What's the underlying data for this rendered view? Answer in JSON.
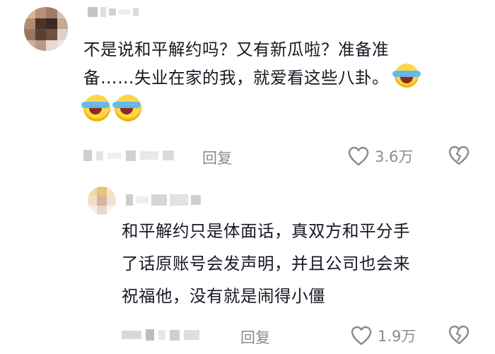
{
  "comment": {
    "text_line1": "不是说和平解约吗？又有新瓜啦？准备准",
    "text_line2": "备……失业在家的我，就爱看这些八卦。",
    "emoji_names": [
      "laughing-tears-emoji",
      "laughing-tears-emoji",
      "laughing-tears-emoji"
    ],
    "reply_label": "回复",
    "like_count": "3.6万"
  },
  "reply": {
    "text_line1": "和平解约只是体面话，真双方和平分手",
    "text_line2": "了话原账号会发声明，并且公司也会来",
    "text_line3": "祝福他，没有就是闹得小僵",
    "reply_label": "回复",
    "like_count": "1.9万"
  },
  "icons": {
    "like": "heart-outline-icon",
    "dislike": "broken-heart-icon"
  },
  "colors": {
    "text": "#161823",
    "meta": "#8a8b91",
    "emoji_yellow": "#ffd54a",
    "tear_blue": "#5fb7f0"
  }
}
